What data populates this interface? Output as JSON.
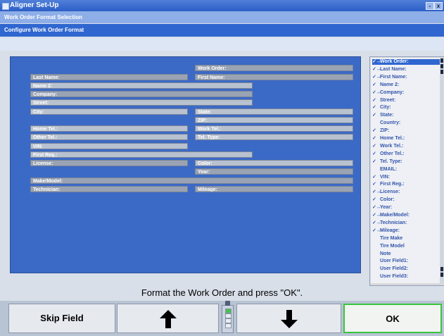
{
  "window": {
    "title": "Aligner Set-Up",
    "icon": "app-icon",
    "buttons": [
      "-",
      "x"
    ]
  },
  "breadcrumb": {
    "parent": "Work Order Format Selection",
    "current": "Configure Work Order Format"
  },
  "form": {
    "fields": [
      {
        "label": "Work Order:"
      },
      {
        "label": "Last Name:"
      },
      {
        "label": "First Name:"
      },
      {
        "label": "Name 2:"
      },
      {
        "label": "Company:"
      },
      {
        "label": "Street:"
      },
      {
        "label": "City:"
      },
      {
        "label": "State:"
      },
      {
        "label": "ZIP:"
      },
      {
        "label": "Home Tel.:"
      },
      {
        "label": "Work Tel.:"
      },
      {
        "label": "Other Tel.:"
      },
      {
        "label": "Tel. Type:"
      },
      {
        "label": "VIN:"
      },
      {
        "label": "First Reg.:"
      },
      {
        "label": "License:"
      },
      {
        "label": "Color:"
      },
      {
        "label": "Year:"
      },
      {
        "label": "Make/Model:"
      },
      {
        "label": "Technician:"
      },
      {
        "label": "Mileage:"
      }
    ]
  },
  "list": {
    "items": [
      {
        "label": "Work Order:",
        "check": "✓↔",
        "selected": true
      },
      {
        "label": "Last Name:",
        "check": "✓↔"
      },
      {
        "label": "First Name:",
        "check": "✓↔"
      },
      {
        "label": "Name 2:",
        "check": "✓"
      },
      {
        "label": "Company:",
        "check": "✓↔"
      },
      {
        "label": "Street:",
        "check": "✓"
      },
      {
        "label": "City:",
        "check": "✓"
      },
      {
        "label": "State:",
        "check": "✓"
      },
      {
        "label": "Country:",
        "check": ""
      },
      {
        "label": "ZIP:",
        "check": "✓"
      },
      {
        "label": "Home Tel.:",
        "check": "✓"
      },
      {
        "label": "Work Tel.:",
        "check": "✓"
      },
      {
        "label": "Other Tel.:",
        "check": "✓"
      },
      {
        "label": "Tel. Type:",
        "check": "✓"
      },
      {
        "label": "EMAIL:",
        "check": ""
      },
      {
        "label": "VIN:",
        "check": "✓"
      },
      {
        "label": "First Reg.:",
        "check": "✓"
      },
      {
        "label": "License:",
        "check": "✓↔"
      },
      {
        "label": "Color:",
        "check": "✓"
      },
      {
        "label": "Year:",
        "check": "✓↔"
      },
      {
        "label": "Make/Model:",
        "check": "✓↔"
      },
      {
        "label": "Technician:",
        "check": "✓↔"
      },
      {
        "label": "Mileage:",
        "check": "✓↔"
      },
      {
        "label": "Tire Make",
        "check": ""
      },
      {
        "label": "Tire Model",
        "check": ""
      },
      {
        "label": "Note",
        "check": ""
      },
      {
        "label": "User Field1:",
        "check": ""
      },
      {
        "label": "User Field2:",
        "check": ""
      },
      {
        "label": "User Field3:",
        "check": ""
      }
    ]
  },
  "prompt": "Format the Work Order and press \"OK\".",
  "buttons": {
    "skip": "Skip Field",
    "up": "up-arrow-icon",
    "down": "down-arrow-icon",
    "ok": "OK"
  },
  "colors": {
    "accent": "#2f66d0",
    "form_bg": "#3b69c6",
    "ok_border": "#39c53e"
  }
}
